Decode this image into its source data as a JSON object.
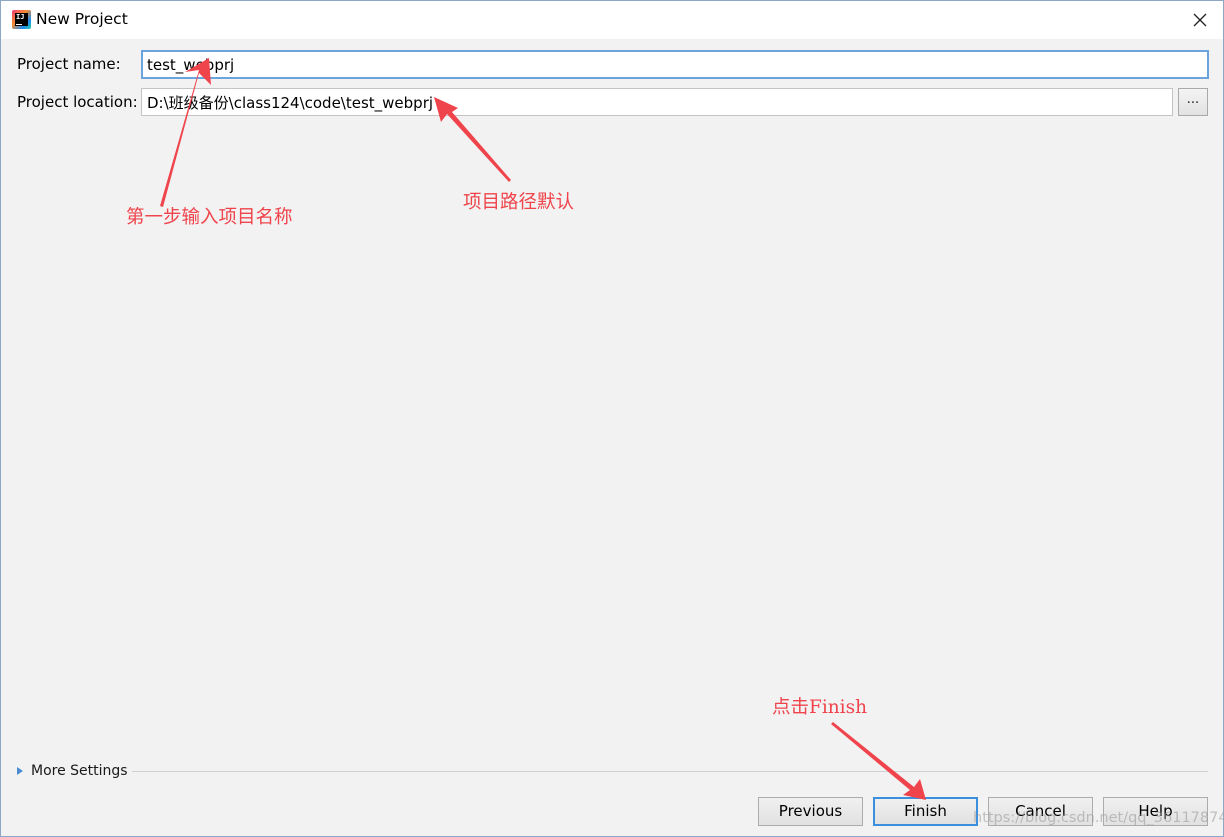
{
  "window": {
    "title": "New Project"
  },
  "form": {
    "project_name_label": "Project name:",
    "project_name_value": "test_webprj",
    "project_location_label": "Project location:",
    "project_location_value": "D:\\班级备份\\class124\\code\\test_webprj",
    "browse_label": "..."
  },
  "annotations": {
    "step1": "第一步输入项目名称",
    "path_default": "项目路径默认",
    "click_finish": "点击Finish"
  },
  "more_settings": {
    "label": "More Settings"
  },
  "buttons": {
    "previous": "Previous",
    "finish": "Finish",
    "cancel": "Cancel",
    "help": "Help"
  },
  "watermark": "https://blog.csdn.net/qq_36117874",
  "colors": {
    "annotation": "#f0444c",
    "focus_border": "#6ba4dc",
    "default_button_border": "#3c8fdc"
  },
  "icons": {
    "app": "intellij-idea-icon",
    "close": "close-icon",
    "more_settings": "triangle-right-icon"
  }
}
